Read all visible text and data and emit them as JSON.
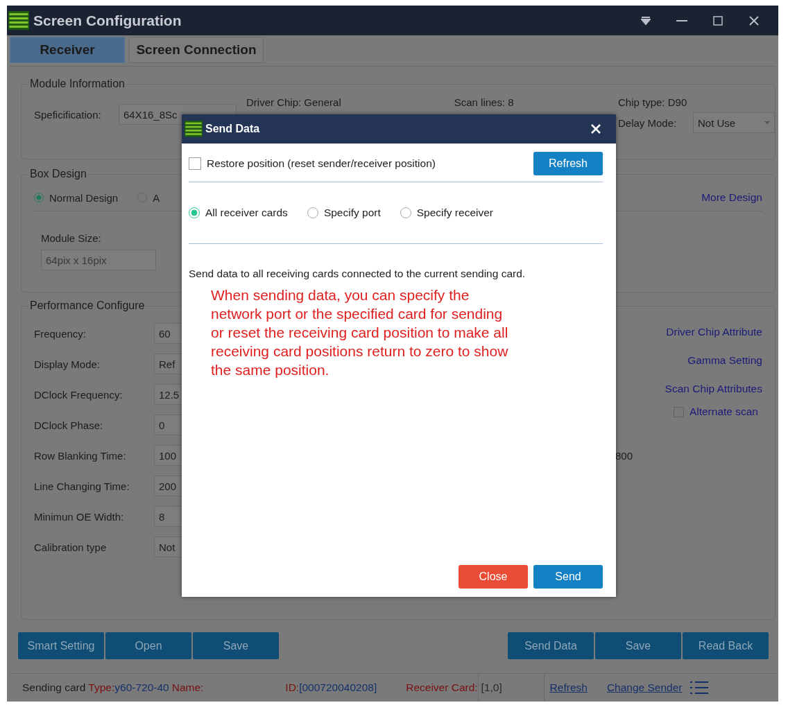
{
  "window": {
    "title": "Screen Configuration"
  },
  "tabs": [
    {
      "label": "Receiver",
      "selected": true
    },
    {
      "label": "Screen Connection",
      "selected": false
    }
  ],
  "module_information": {
    "title": "Module Information",
    "specification": {
      "label": "Speficification:",
      "value": "64X16_8Sc"
    },
    "driver_chip": "Driver Chip:  General",
    "scan_lines": "Scan lines:  8",
    "chip_type": "Chip type:  D90",
    "delay_mode": {
      "label": "Delay Mode:",
      "value": "Not Use"
    }
  },
  "box_design": {
    "title": "Box Design",
    "options": [
      {
        "label": "Normal Design",
        "selected": true
      },
      {
        "label": "A",
        "selected": false
      }
    ],
    "more_design": "More Design",
    "module_size": {
      "label": "Module Size:",
      "value": "64pix x 16pix"
    }
  },
  "performance": {
    "title": "Performance Configure",
    "rows": [
      {
        "label": "Frequency:",
        "value": "60"
      },
      {
        "label": "Display Mode:",
        "value": "Ref"
      },
      {
        "label": "DClock Frequency:",
        "value": "12.5"
      },
      {
        "label": "DClock Phase:",
        "value": "0"
      },
      {
        "label": "Row Blanking Time:",
        "value": "100",
        "extra": "800"
      },
      {
        "label": "Line Changing Time:",
        "value": "200"
      },
      {
        "label": "Minimun OE Width:",
        "value": "8"
      },
      {
        "label": "Calibration type",
        "value": "Not"
      }
    ],
    "links": [
      "Driver Chip Attribute",
      "Gamma Setting",
      "Scan Chip Attributes"
    ],
    "alternate_scan": {
      "label": "Alternate scan",
      "checked": false
    }
  },
  "left_buttons": [
    "Smart Setting",
    "Open",
    "Save"
  ],
  "right_buttons": [
    "Send Data",
    "Save",
    "Read Back"
  ],
  "status_bar": {
    "sending_card": "Sending card",
    "type_label": "Type:",
    "type_value": "y60-720-40",
    "name_label": "Name:",
    "id_label": "ID:",
    "id_value": "[000720040208]",
    "receiver_label": "Receiver Card:",
    "receiver_value": "[1,0]",
    "refresh": "Refresh",
    "change_sender": "Change Sender"
  },
  "dialog": {
    "title": "Send Data",
    "restore": {
      "label": "Restore position (reset sender/receiver position)",
      "checked": false
    },
    "refresh": "Refresh",
    "scope": [
      {
        "label": "All receiver cards",
        "selected": true
      },
      {
        "label": "Specify port",
        "selected": false
      },
      {
        "label": "Specify receiver",
        "selected": false
      }
    ],
    "description": "Send data to all receiving cards connected to the current sending card.",
    "note": "When sending data, you can specify the network port or the specified card for sending or reset the receiving card position to make all receiving card positions return to zero to show the same position.",
    "close": "Close",
    "send": "Send"
  }
}
